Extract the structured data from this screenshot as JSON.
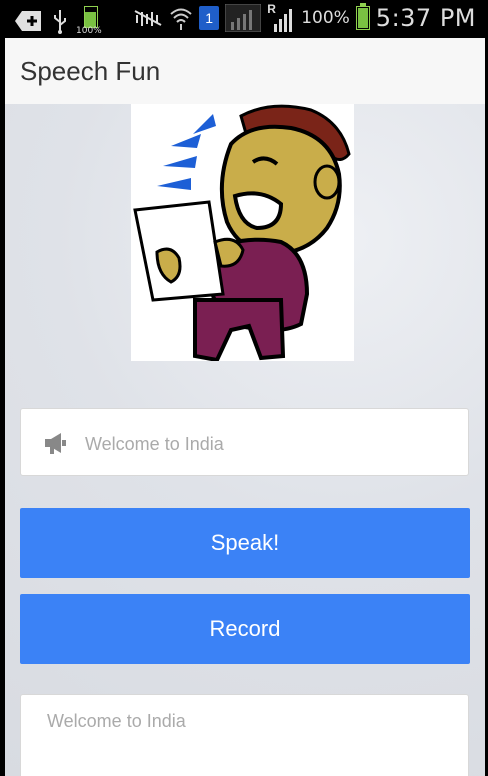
{
  "status_bar": {
    "icons": [
      "back-notification-icon",
      "usb-icon",
      "battery-notification-icon",
      "mute-icon",
      "wifi-icon",
      "sim-icon",
      "signal-icon",
      "roaming-signal-icon",
      "battery-icon"
    ],
    "small_battery_label": "100%",
    "sim_label": "1",
    "roaming_label": "R",
    "battery_percent": "100%",
    "time": "5:37 PM"
  },
  "app": {
    "title": "Speech Fun"
  },
  "hero_image": {
    "description_icon": "cartoon-speaker-image"
  },
  "speech_input": {
    "placeholder": "Welcome to India",
    "value": "",
    "icon": "megaphone-icon"
  },
  "buttons": {
    "speak_label": "Speak!",
    "record_label": "Record"
  },
  "result_box": {
    "placeholder": "Welcome to India",
    "value": ""
  },
  "colors": {
    "primary": "#3b82f6",
    "status_bar": "#000000",
    "app_bar": "#f7f7f7"
  }
}
